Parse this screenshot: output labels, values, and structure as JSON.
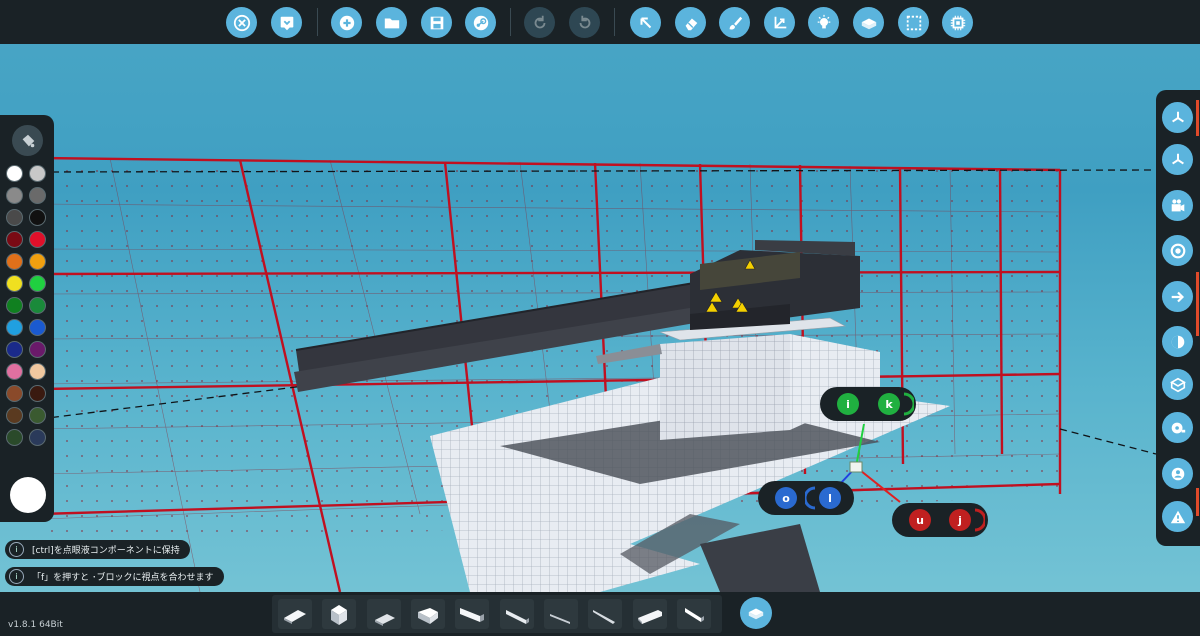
{
  "toolbar": {
    "groups": [
      [
        "close-button",
        "hint-button"
      ],
      [
        "new-button",
        "open-button",
        "save-button",
        "steam-button"
      ],
      [
        "undo-button",
        "redo-button"
      ],
      [
        "select-tool",
        "erase-tool",
        "paint-tool",
        "axis-tool",
        "light-tool",
        "components-tool",
        "selection-box-tool",
        "logic-tool"
      ]
    ],
    "disabled": [
      "undo-button",
      "redo-button"
    ]
  },
  "palette": {
    "colors": [
      "#ffffff",
      "#c8c8c8",
      "#8a8a8a",
      "#6a6a6a",
      "#4a4a4a",
      "#111111",
      "#7a0a14",
      "#e0102a",
      "#e0701a",
      "#f0a010",
      "#f0e020",
      "#20d040",
      "#108020",
      "#1a8a3a",
      "#20a0e0",
      "#1a5ad0",
      "#1a2a8a",
      "#6a1a6a",
      "#e070a0",
      "#f0c8a0",
      "#8a4a2a",
      "#3a1a10",
      "#5a3a20",
      "#3a5a30",
      "#2a4a2a",
      "#2a3a5a"
    ],
    "selected_color": "#ffffff"
  },
  "hints": [
    {
      "icon": "i",
      "text": "[ctrl]を点眼液コンポーネントに保持"
    },
    {
      "icon": "i",
      "text": "「f」を押すと ･ブロックに視点を合わせます"
    }
  ],
  "version": "v1.8.1 64Bit",
  "gizmo": {
    "green": {
      "left_key": "i",
      "right_key": "k"
    },
    "blue": {
      "left_key": "o",
      "right_key": "l"
    },
    "red": {
      "left_key": "u",
      "right_key": "j"
    }
  },
  "right_panel": {
    "buttons": [
      "view-top-icon",
      "view-iso-icon",
      "camera-icon",
      "toggle-icon",
      "arrow-icon",
      "half-circle-icon",
      "block-icon",
      "tape-icon",
      "inventory-icon",
      "warning-icon"
    ]
  },
  "shapes": [
    "block-small",
    "cube",
    "slope",
    "wedge",
    "slope-long",
    "wedge-corner",
    "ramp",
    "pyramid",
    "ramp-long",
    "wedge-thin"
  ]
}
